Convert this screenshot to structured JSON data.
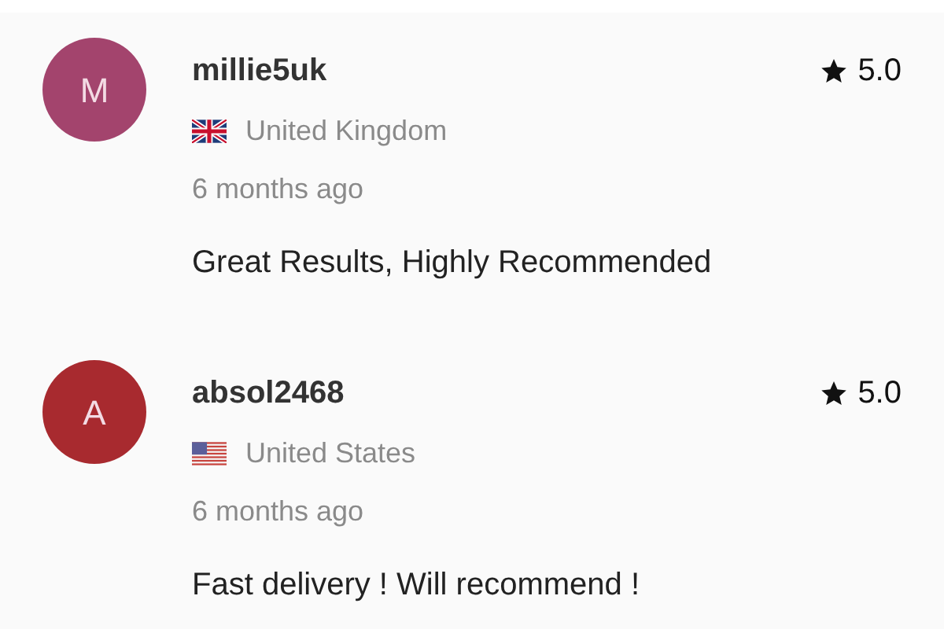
{
  "reviews": [
    {
      "initial": "M",
      "color": "#a3446d",
      "username": "millie5uk",
      "rating": "5.0",
      "kind": "uk",
      "country": "United Kingdom",
      "time": "6 months ago",
      "text": "Great Results, Highly Recommended"
    },
    {
      "initial": "A",
      "color": "#a82a2f",
      "username": "absol2468",
      "rating": "5.0",
      "kind": "us",
      "country": "United States",
      "time": "6 months ago",
      "text": "Fast delivery ! Will recommend !"
    }
  ]
}
